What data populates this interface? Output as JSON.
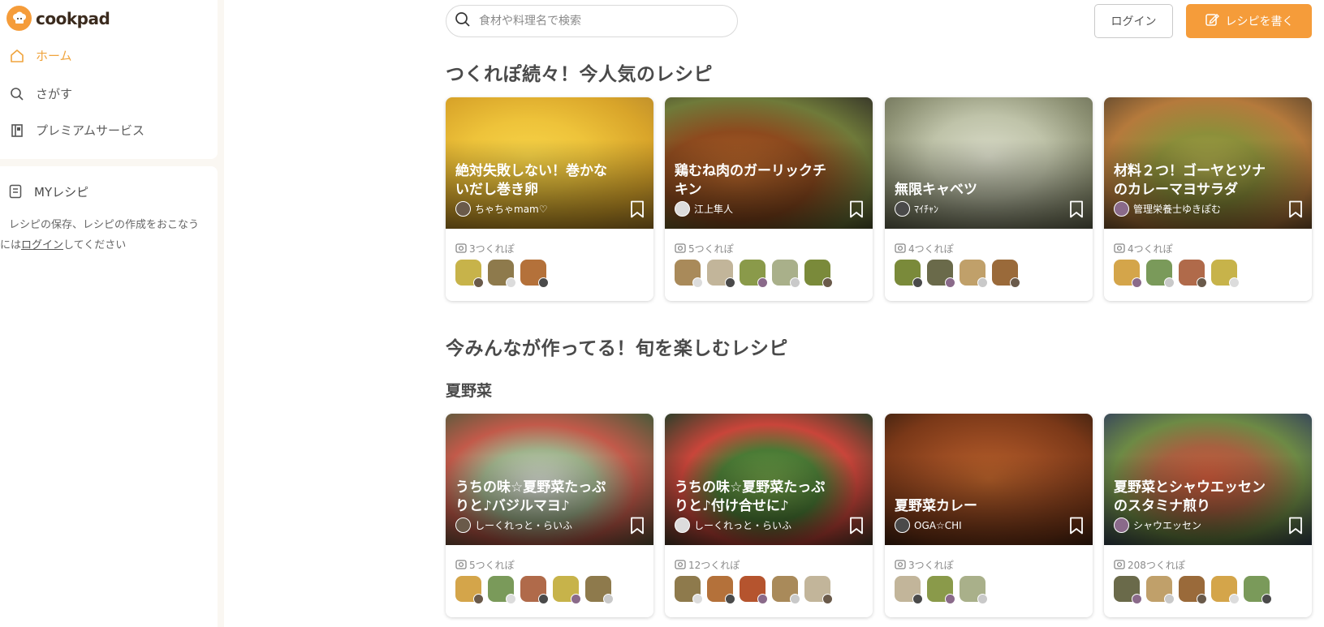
{
  "brand": {
    "name": "cookpad",
    "accent": "#f59c3a"
  },
  "sidebar": {
    "nav": [
      {
        "label": "ホーム",
        "icon": "home-icon"
      },
      {
        "label": "さがす",
        "icon": "search-icon"
      },
      {
        "label": "プレミアムサービス",
        "icon": "premium-icon"
      }
    ],
    "my_recipe": {
      "title": "MYレシピ",
      "desc_before": "レシピの保存、レシピの作成をおこなう",
      "desc_prefix": "には",
      "desc_link": "ログイン",
      "desc_after": "してください"
    }
  },
  "header": {
    "search_placeholder": "食材や料理名で検索",
    "login_label": "ログイン",
    "write_label": "レシピを書く"
  },
  "section1": {
    "title": "つくれぽ続々！今人気のレシピ",
    "cards": [
      {
        "title": "絶対失敗しない！巻かないだし巻き卵",
        "author": "ちゃちゃmam♡",
        "tsukurepo": "3つくれぽ",
        "thumb_count": 3
      },
      {
        "title": "鶏むね肉のガーリックチキン",
        "author": "江上隼人",
        "tsukurepo": "5つくれぽ",
        "thumb_count": 5
      },
      {
        "title": "無限キャベツ",
        "author": "ﾏｲﾁｬﾝ",
        "tsukurepo": "4つくれぽ",
        "thumb_count": 4
      },
      {
        "title": "材料２つ！ゴーヤとツナのカレーマヨサラダ",
        "author": "管理栄養士ゆきぽむ",
        "tsukurepo": "4つくれぽ",
        "thumb_count": 4
      }
    ]
  },
  "section2": {
    "title": "今みんなが作ってる！旬を楽しむレシピ",
    "subtitle": "夏野菜",
    "cards": [
      {
        "title": "うちの味☆夏野菜たっぷりと♪バジルマヨ♪",
        "author": "しーくれっと・らいふ",
        "tsukurepo": "5つくれぽ",
        "thumb_count": 5
      },
      {
        "title": "うちの味☆夏野菜たっぷりと♪付け合せに♪",
        "author": "しーくれっと・らいふ",
        "tsukurepo": "12つくれぽ",
        "thumb_count": 5
      },
      {
        "title": "夏野菜カレー",
        "author": "OGA☆CHI",
        "tsukurepo": "3つくれぽ",
        "thumb_count": 3
      },
      {
        "title": "夏野菜とシャウエッセンのスタミナ煎り",
        "author": "シャウエッセン",
        "tsukurepo": "208つくれぽ",
        "thumb_count": 5
      }
    ]
  }
}
